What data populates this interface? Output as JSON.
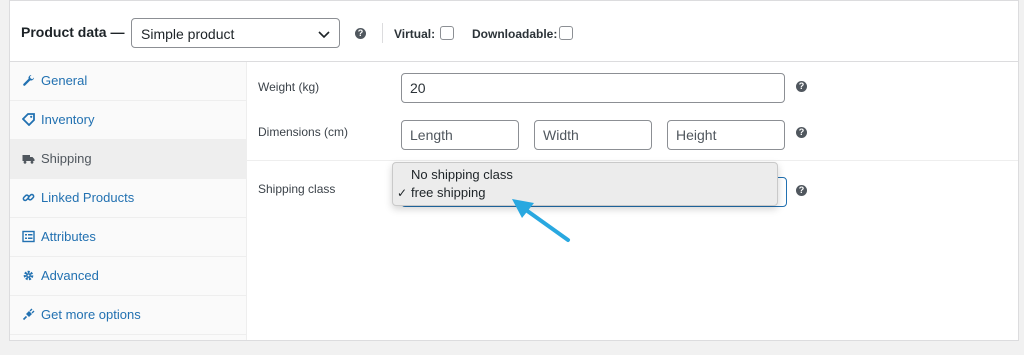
{
  "header": {
    "title": "Product data —",
    "product_type": "Simple product",
    "virtual_label": "Virtual:",
    "downloadable_label": "Downloadable:"
  },
  "sidebar": {
    "items": [
      {
        "label": "General",
        "icon": "wrench-icon"
      },
      {
        "label": "Inventory",
        "icon": "tag-icon"
      },
      {
        "label": "Shipping",
        "icon": "truck-icon",
        "active": true
      },
      {
        "label": "Linked Products",
        "icon": "link-icon"
      },
      {
        "label": "Attributes",
        "icon": "list-icon"
      },
      {
        "label": "Advanced",
        "icon": "gear-icon"
      },
      {
        "label": "Get more options",
        "icon": "plugin-icon"
      }
    ]
  },
  "shipping": {
    "weight_label": "Weight (kg)",
    "weight_value": "20",
    "dimensions_label": "Dimensions (cm)",
    "length_placeholder": "Length",
    "width_placeholder": "Width",
    "height_placeholder": "Height",
    "class_label": "Shipping class",
    "class_options": [
      "No shipping class",
      "free shipping"
    ],
    "class_selected": "free shipping",
    "checkmark": "✓"
  },
  "colors": {
    "link": "#2271b1",
    "accent_arrow": "#29a8e0"
  }
}
